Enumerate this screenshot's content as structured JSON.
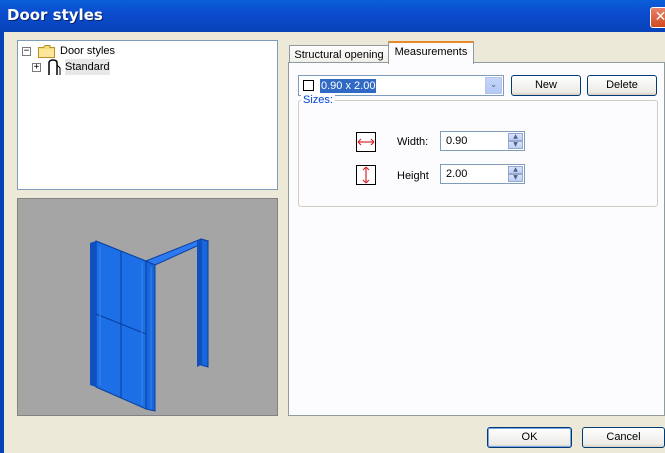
{
  "window": {
    "title": "Door styles",
    "close_glyph": "✕"
  },
  "tree": {
    "root": {
      "label": "Door styles",
      "expander": "−",
      "icon": "folder-icon"
    },
    "child": {
      "label": "Standard",
      "expander": "+",
      "icon": "door-style-icon"
    }
  },
  "tabs": [
    {
      "label": "Structural opening",
      "active": false
    },
    {
      "label": "Measurements",
      "active": true
    }
  ],
  "style_select": {
    "value": "0.90 x 2.00",
    "arrow": "⌄"
  },
  "buttons": {
    "new": "New",
    "delete": "Delete",
    "ok": "OK",
    "cancel": "Cancel"
  },
  "sizes": {
    "group_label": "Sizes:",
    "width": {
      "label": "Width:",
      "value": "0.90",
      "icon": "width-arrow-icon"
    },
    "height": {
      "label": "Height",
      "value": "2.00",
      "icon": "height-arrow-icon"
    }
  },
  "spin_glyphs": {
    "up": "▲",
    "down": "▼"
  },
  "colors": {
    "title_bar": "#0a5fd8",
    "door_model": "#1e6fe0",
    "preview_bg": "#a5a5a5",
    "selection": "#316ac5",
    "arrow_red": "#d9262b"
  }
}
